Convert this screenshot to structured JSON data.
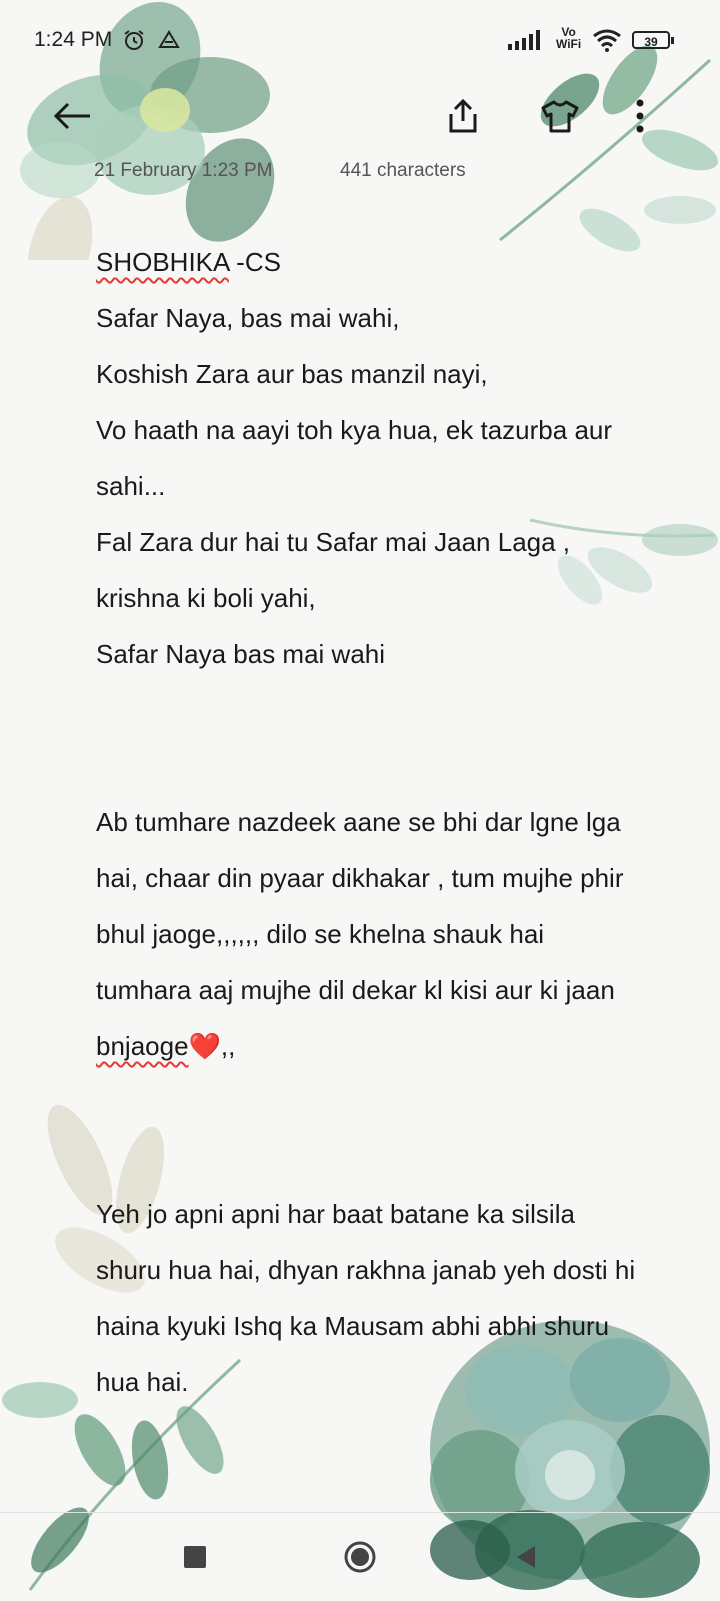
{
  "status_bar": {
    "time": "1:24 PM",
    "volte_top": "Vo",
    "volte_bottom": "WiFi",
    "battery": "39"
  },
  "toolbar": {
    "back_icon": "arrow-left-icon",
    "share_icon": "share-icon",
    "theme_icon": "shirt-icon",
    "more_icon": "more-vertical-icon"
  },
  "note": {
    "date": "21 February  1:23 PM",
    "char_count": "441 characters",
    "title_a": "SHOBHIKA",
    "title_b": " -CS",
    "lines": [
      "Safar Naya, bas mai wahi,",
      "Koshish Zara aur bas manzil nayi,",
      "Vo haath na aayi toh kya hua, ek tazurba aur sahi...",
      "Fal Zara dur hai tu Safar mai Jaan Laga , krishna ki boli yahi,",
      "Safar Naya bas mai wahi"
    ],
    "para2_a": "Ab tumhare nazdeek aane se bhi dar lgne lga hai, chaar din pyaar dikhakar , tum mujhe phir bhul jaoge,,,,,, dilo se khelna shauk  hai tumhara aaj mujhe dil dekar kl kisi aur ki jaan ",
    "para2_b": "bnjaoge",
    "para2_c": "❤️,,",
    "para3": "Yeh jo apni apni har baat batane ka silsila shuru hua hai, dhyan rakhna janab yeh dosti hi haina kyuki Ishq ka Mausam abhi abhi shuru hua hai."
  },
  "nav": {
    "recents_icon": "square-icon",
    "home_icon": "circle-icon",
    "back_icon": "triangle-back-icon"
  },
  "colors": {
    "background": "#f7f7f6",
    "leaf_dark": "#3f7a5c",
    "leaf_light": "#9cc7b1",
    "spellcheck": "#e53935"
  }
}
